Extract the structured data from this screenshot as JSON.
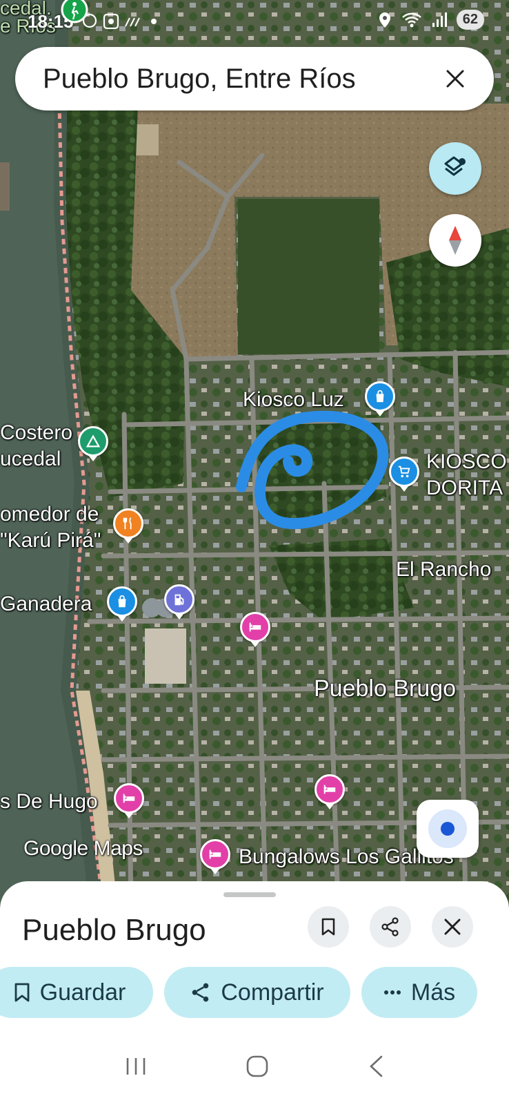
{
  "status_bar": {
    "time": "18:15",
    "battery": "62"
  },
  "search": {
    "query": "Pueblo Brugo, Entre Ríos"
  },
  "map": {
    "partial_labels": [
      "cedal.",
      "e Ríos"
    ],
    "labels": [
      {
        "id": "kiosco-luz",
        "text": "Kiosco Luz"
      },
      {
        "id": "kiosco-dorita-1",
        "text": "KIOSCO"
      },
      {
        "id": "kiosco-dorita-2",
        "text": "DORITA"
      },
      {
        "id": "costero-1",
        "text": "Costero"
      },
      {
        "id": "costero-2",
        "text": "ucedal"
      },
      {
        "id": "comedor-1",
        "text": "omedor de"
      },
      {
        "id": "comedor-2",
        "text": "\"Karú Pirá\""
      },
      {
        "id": "ganadera",
        "text": "Ganadera"
      },
      {
        "id": "el-rancho",
        "text": "El Rancho"
      },
      {
        "id": "pueblo-brugo",
        "text": "Pueblo Brugo"
      },
      {
        "id": "de-hugo",
        "text": "s De Hugo"
      },
      {
        "id": "bungalows",
        "text": "Bungalows Los Gallitos"
      }
    ],
    "pins": [
      {
        "id": "kiosco-luz-pin",
        "icon": "shopping-bag-icon",
        "color": "#1a8fe3"
      },
      {
        "id": "kiosco-dorita-pin",
        "icon": "cart-icon",
        "color": "#1a8fe3"
      },
      {
        "id": "costero-pin",
        "icon": "tent-icon",
        "color": "#1e9c6c"
      },
      {
        "id": "comedor-pin",
        "icon": "restaurant-icon",
        "color": "#f08222"
      },
      {
        "id": "ganadera-pin",
        "icon": "shopping-bag-icon",
        "color": "#1a8fe3"
      },
      {
        "id": "fuel-pin",
        "icon": "gas-station-icon",
        "color": "#6e72d8"
      },
      {
        "id": "hotel-pin-1",
        "icon": "bed-icon",
        "color": "#e23fa8"
      },
      {
        "id": "hotel-pin-2",
        "icon": "bed-icon",
        "color": "#e23fa8"
      },
      {
        "id": "hotel-pin-3",
        "icon": "bed-icon",
        "color": "#e23fa8"
      },
      {
        "id": "hotel-pin-4",
        "icon": "bed-icon",
        "color": "#e23fa8"
      }
    ],
    "annotation_color": "#2b8ce6",
    "logo": "Google Maps"
  },
  "bottom_sheet": {
    "title": "Pueblo Brugo",
    "chips": {
      "save": "Guardar",
      "share": "Compartir",
      "more": "Más"
    }
  }
}
